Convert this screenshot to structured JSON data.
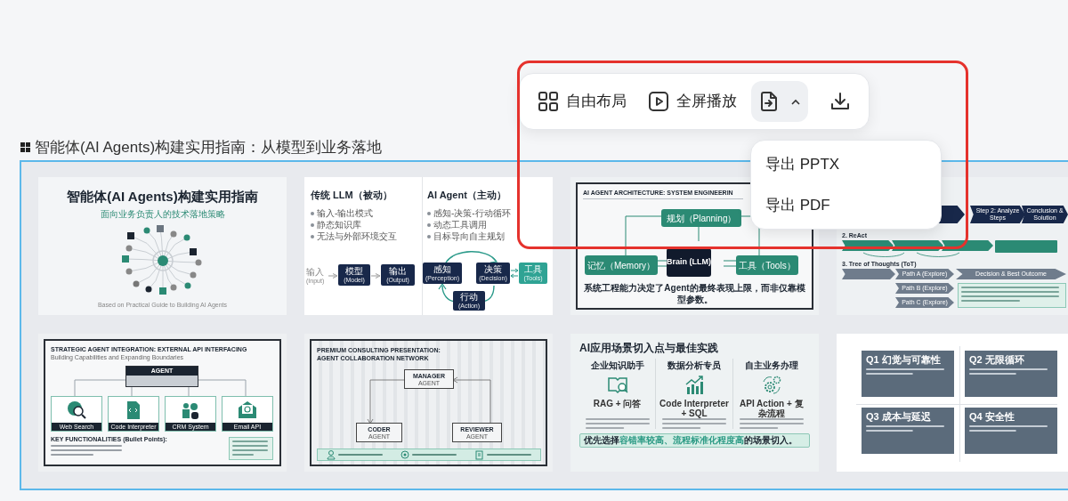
{
  "toolbar": {
    "buttons": [
      {
        "kind": "layout",
        "label": "自由布局",
        "active": false
      },
      {
        "kind": "play",
        "label": "全屏播放",
        "active": false
      },
      {
        "kind": "export",
        "active": true
      },
      {
        "kind": "download",
        "active": false
      }
    ]
  },
  "export_menu": {
    "items": [
      "导出 PPTX",
      "导出 PDF"
    ]
  },
  "deck": {
    "title": "智能体(AI Agents)构建实用指南：从模型到业务落地",
    "slides": [
      {
        "kind": "title",
        "title": "智能体(AI Agents)构建实用指南",
        "subtitle": "面向业务负责人的技术落地策略",
        "footer": "Based on Practical Guide to Building AI Agents"
      },
      {
        "kind": "compare",
        "columns": [
          {
            "heading": "传统 LLM（被动）",
            "bullets": [
              "输入-输出模式",
              "静态知识库",
              "无法与外部环境交互"
            ]
          },
          {
            "heading": "AI Agent（主动）",
            "bullets": [
              "感知-决策-行动循环",
              "动态工具调用",
              "目标导向自主规划"
            ]
          }
        ],
        "flow": [
          {
            "label": "输入",
            "en": "(Input)"
          },
          {
            "label": "模型",
            "en": "(Model)"
          },
          {
            "label": "输出",
            "en": "(Output)"
          }
        ],
        "cycle": [
          {
            "label": "感知",
            "en": "(Perception)"
          },
          {
            "label": "决策",
            "en": "(Decision)"
          },
          {
            "label": "工具",
            "en": "(Tools)"
          },
          {
            "label": "行动",
            "en": "(Action)"
          }
        ]
      },
      {
        "kind": "architecture",
        "title": "AI AGENT ARCHITECTURE: SYSTEM ENGINEERIN",
        "nodes": [
          "规划（Planning）",
          "记忆（Memory）",
          "Brain (LLM)",
          "工具（Tools）"
        ],
        "footer": "系统工程能力决定了Agent的最终表现上限，而非仅靠模型参数。"
      },
      {
        "kind": "reasoning",
        "steps": [
          "Step 2: Analyze Steps",
          "Conclusion & Solution"
        ],
        "sections": [
          "2. ReAct",
          "3. Tree of Thoughts (ToT)"
        ],
        "paths": [
          "Path A (Explore)",
          "Path B (Explore)",
          "Path C (Explore)"
        ],
        "outcome": "Decision & Best Outcome"
      },
      {
        "kind": "integration",
        "title": "STRATEGIC AGENT INTEGRATION: EXTERNAL API INTERFACING",
        "subtitle": "Building Capabilities and Expanding Boundaries",
        "hub": "AGENT",
        "tools": [
          "Web Search",
          "Code Interpreter",
          "CRM System",
          "Email API"
        ],
        "list_title": "KEY FUNCTIONALITIES (Bullet Points):"
      },
      {
        "kind": "collaboration",
        "title": [
          "PREMIUM CONSULTING PRESENTATION:",
          "AGENT COLLABORATION NETWORK"
        ],
        "agents": [
          {
            "role": "MANAGER",
            "sub": "AGENT"
          },
          {
            "role": "CODER",
            "sub": "AGENT"
          },
          {
            "role": "REVIEWER",
            "sub": "AGENT"
          }
        ]
      },
      {
        "kind": "scenarios",
        "title": "AI应用场景切入点与最佳实践",
        "columns": [
          {
            "heading": "企业知识助手",
            "sub": "RAG + 问答"
          },
          {
            "heading": "数据分析专员",
            "sub": "Code Interpreter + SQL"
          },
          {
            "heading": "自主业务办理",
            "sub": "API Action + 复杂流程"
          }
        ],
        "footer": "优先选择**容错率较高、流程标准化程度高**的场景切入。"
      },
      {
        "kind": "risks",
        "cards": [
          "Q1 幻觉与可靠性",
          "Q2 无限循环",
          "Q3 成本与延迟",
          "Q4 安全性"
        ]
      }
    ]
  }
}
